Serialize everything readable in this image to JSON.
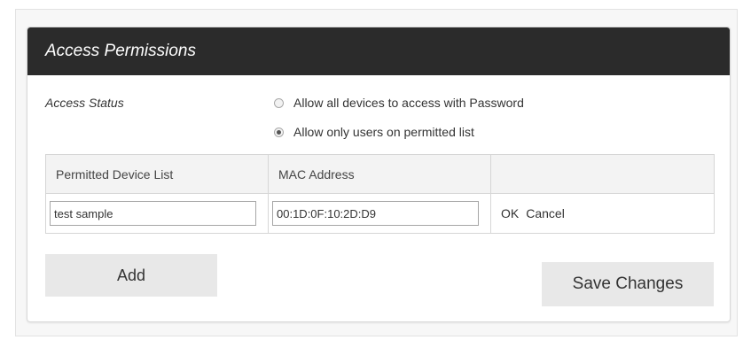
{
  "panel": {
    "title": "Access Permissions"
  },
  "access_status": {
    "label": "Access Status",
    "options": [
      {
        "label": "Allow all devices to access with Password",
        "selected": false
      },
      {
        "label": "Allow only users on permitted list",
        "selected": true
      }
    ]
  },
  "table": {
    "headers": [
      "Permitted Device List",
      "MAC Address",
      ""
    ],
    "rows": [
      {
        "device_name": "test sample",
        "mac_address": "00:1D:0F:10:2D:D9",
        "ok_label": "OK",
        "cancel_label": "Cancel"
      }
    ]
  },
  "buttons": {
    "add_label": "Add",
    "save_label": "Save Changes"
  },
  "colors": {
    "header_bg": "#2b2b2b",
    "button_bg": "#e8e8e8",
    "table_header_bg": "#f3f3f3"
  }
}
